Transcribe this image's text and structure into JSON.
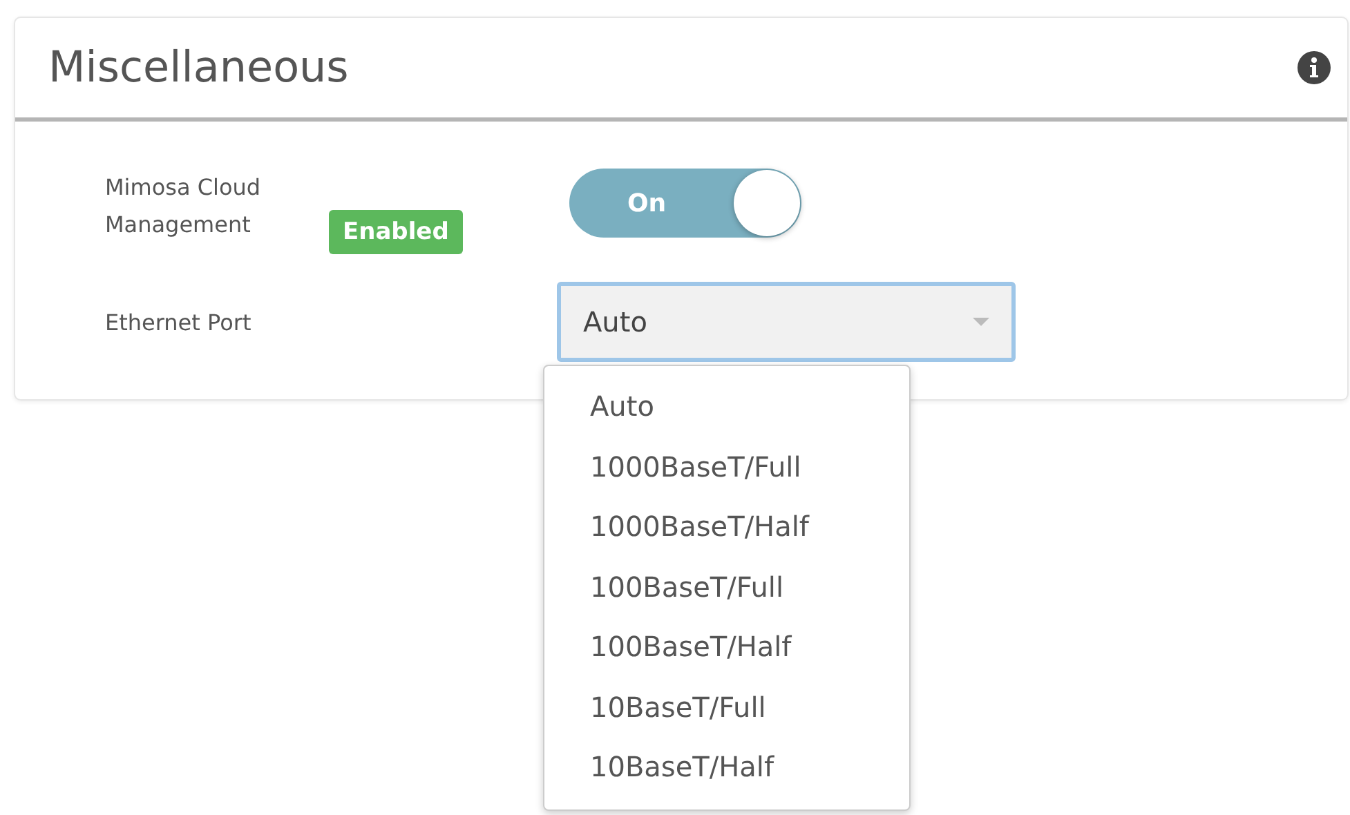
{
  "panel": {
    "title": "Miscellaneous"
  },
  "cloud_management": {
    "label": "Mimosa Cloud Management",
    "badge": "Enabled",
    "toggle": {
      "on": true,
      "label": "On"
    }
  },
  "ethernet_port": {
    "label": "Ethernet Port",
    "value": "Auto",
    "expanded": true,
    "options": [
      {
        "label": "Auto"
      },
      {
        "label": "1000BaseT/Full"
      },
      {
        "label": "1000BaseT/Half"
      },
      {
        "label": "100BaseT/Full"
      },
      {
        "label": "100BaseT/Half"
      },
      {
        "label": "10BaseT/Full"
      },
      {
        "label": "10BaseT/Half"
      }
    ]
  }
}
